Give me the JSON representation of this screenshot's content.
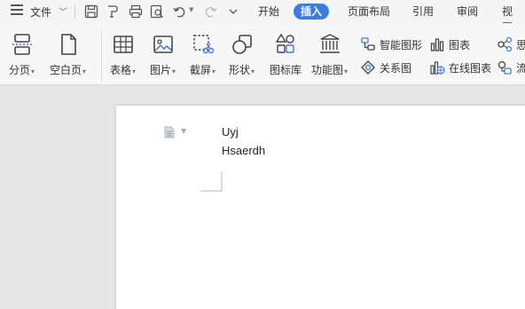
{
  "menubar": {
    "file_label": "文件",
    "tabs": [
      {
        "label": "开始"
      },
      {
        "label": "插入"
      },
      {
        "label": "页面布局"
      },
      {
        "label": "引用"
      },
      {
        "label": "审阅"
      },
      {
        "label": "视图"
      }
    ],
    "active_tab": "插入"
  },
  "ribbon": {
    "buttons": [
      {
        "label": "分页",
        "icon": "page-break-icon",
        "dropdown": true
      },
      {
        "label": "空白页",
        "icon": "blank-page-icon",
        "dropdown": true
      },
      {
        "label": "表格",
        "icon": "table-icon",
        "dropdown": true
      },
      {
        "label": "图片",
        "icon": "picture-icon",
        "dropdown": true
      },
      {
        "label": "截屏",
        "icon": "screenshot-icon",
        "dropdown": true
      },
      {
        "label": "形状",
        "icon": "shape-icon",
        "dropdown": true
      },
      {
        "label": "图标库",
        "icon": "icon-library-icon",
        "dropdown": false
      },
      {
        "label": "功能图",
        "icon": "function-chart-icon",
        "dropdown": true
      }
    ],
    "small_buttons": [
      {
        "label": "智能图形",
        "icon": "smartart-icon"
      },
      {
        "label": "关系图",
        "icon": "relation-chart-icon"
      },
      {
        "label": "图表",
        "icon": "chart-icon"
      },
      {
        "label": "在线图表",
        "icon": "online-chart-icon"
      },
      {
        "label": "思",
        "icon": "mindmap-icon"
      },
      {
        "label": "流",
        "icon": "flowchart-icon"
      }
    ]
  },
  "document": {
    "lines": [
      "Uyj",
      "Hsaerdh"
    ]
  },
  "colors": {
    "accent": "#3d7ddf",
    "menubar_bg": "#f5f5f5",
    "ribbon_bg": "#f7f7f7",
    "workspace_bg": "#e6e6e6",
    "page_bg": "#ffffff"
  }
}
